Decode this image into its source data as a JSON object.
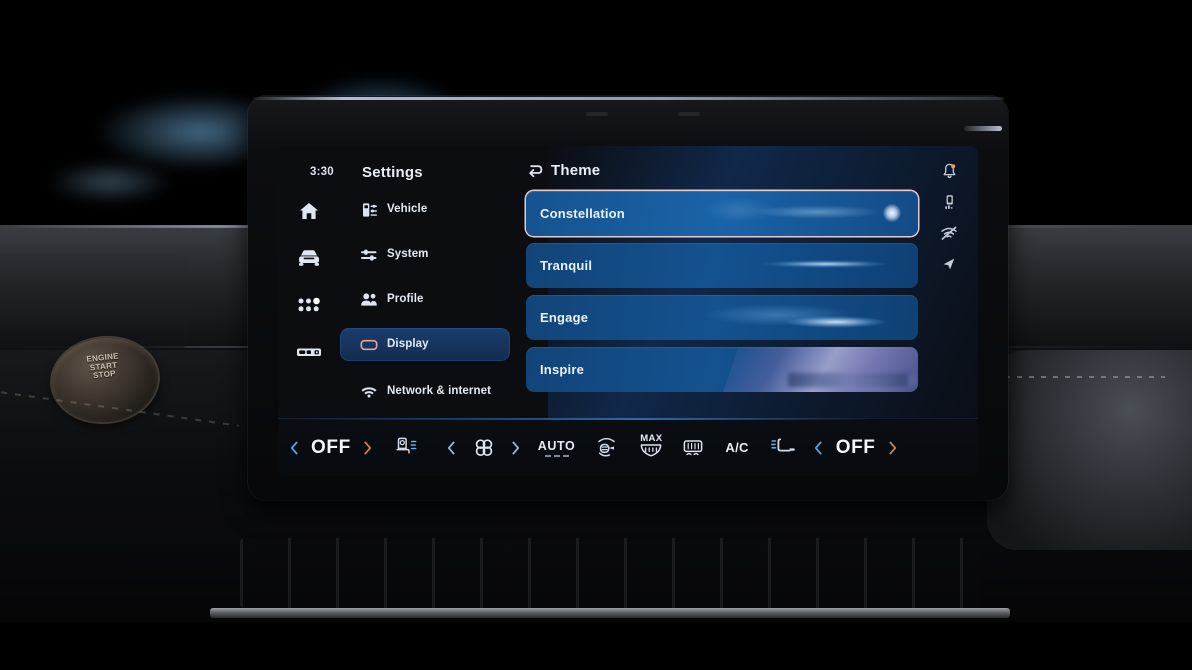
{
  "screen": {
    "clock": "3:30",
    "settings_title": "Settings",
    "left_rail": [
      {
        "name": "home-icon",
        "label": "Home"
      },
      {
        "name": "vehicle-icon",
        "label": "Vehicle"
      },
      {
        "name": "apps-grid-icon",
        "label": "Apps"
      },
      {
        "name": "media-bar-icon",
        "label": "Media"
      }
    ],
    "settings_items": [
      {
        "label": "Vehicle",
        "icon": "vehicle-settings-icon",
        "active": false
      },
      {
        "label": "System",
        "icon": "sliders-icon",
        "active": false
      },
      {
        "label": "Profile",
        "icon": "profile-people-icon",
        "active": false
      },
      {
        "label": "Display",
        "icon": "display-screen-icon",
        "active": true
      },
      {
        "label": "Network & internet",
        "icon": "wifi-icon",
        "active": false
      }
    ],
    "theme": {
      "back_label": "back-arrow",
      "title": "Theme",
      "options": [
        {
          "label": "Constellation",
          "selected": true
        },
        {
          "label": "Tranquil",
          "selected": false
        },
        {
          "label": "Engage",
          "selected": false
        },
        {
          "label": "Inspire",
          "selected": false
        }
      ]
    },
    "status_icons": [
      {
        "name": "bell-icon"
      },
      {
        "name": "phone-signal-icon"
      },
      {
        "name": "wifi-off-icon"
      },
      {
        "name": "navigation-arrow-icon"
      }
    ],
    "climate": {
      "left_temp": "OFF",
      "right_temp": "OFF",
      "auto_label": "AUTO",
      "max_label": "MAX",
      "ac_label": "A/C",
      "left_prev": "chevron-left",
      "left_next": "chevron-right",
      "right_prev": "chevron-left",
      "right_next": "chevron-right",
      "buttons": [
        {
          "name": "driver-seat-heater",
          "label": "Driver seat heater"
        },
        {
          "name": "fan-speed",
          "label": "Fan"
        },
        {
          "name": "airflow-direction",
          "label": "Airflow"
        },
        {
          "name": "max-defrost",
          "label": "MAX defrost"
        },
        {
          "name": "rear-defrost",
          "label": "Rear defrost"
        },
        {
          "name": "ac-toggle",
          "label": "A/C"
        },
        {
          "name": "passenger-seat-heater",
          "label": "Passenger seat heater"
        }
      ]
    }
  },
  "cabin": {
    "start_button_line1": "ENGINE",
    "start_button_line2": "START",
    "start_button_line3": "STOP"
  },
  "colors": {
    "accent_orange": "#c97f52",
    "accent_blue": "#5aa0e6",
    "selected_border": "#e2ccd0",
    "row_blue": "#14518c",
    "text_primary": "#eaf1fa"
  }
}
